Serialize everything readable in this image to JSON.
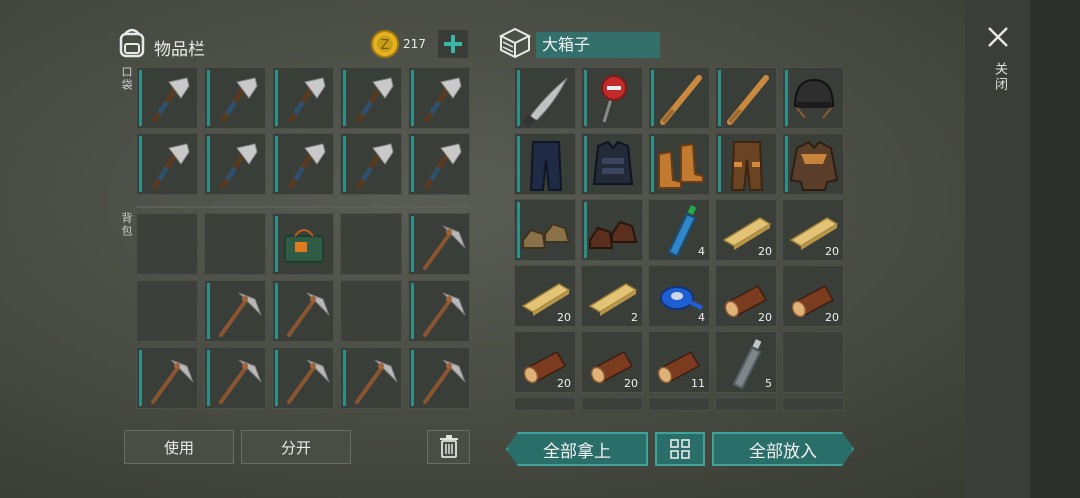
{
  "inventory": {
    "title": "物品栏",
    "coins": "217",
    "pocket_label": "口袋",
    "backpack_label": "背包"
  },
  "container": {
    "title": "大箱子"
  },
  "buttons": {
    "use": "使用",
    "split": "分开",
    "take_all": "全部拿上",
    "put_all": "全部放入"
  },
  "close_label": "关闭",
  "pocket_items": [
    "pickaxe",
    "pickaxe",
    "pickaxe",
    "pickaxe",
    "pickaxe",
    "pickaxe",
    "pickaxe",
    "pickaxe",
    "pickaxe",
    "pickaxe"
  ],
  "backpack_items": [
    "",
    "",
    "tackle-box",
    "",
    "stone-pick",
    "",
    "stone-pick",
    "stone-pick",
    "",
    "stone-pick",
    "stone-pick",
    "stone-pick",
    "stone-pick",
    "stone-pick",
    "stone-pick"
  ],
  "chest_items": [
    {
      "icon": "machete",
      "count": ""
    },
    {
      "icon": "stop-sign",
      "count": ""
    },
    {
      "icon": "bat",
      "count": ""
    },
    {
      "icon": "bat",
      "count": ""
    },
    {
      "icon": "helmet",
      "count": ""
    },
    {
      "icon": "pants-blue",
      "count": ""
    },
    {
      "icon": "vest",
      "count": ""
    },
    {
      "icon": "boots-orange",
      "count": ""
    },
    {
      "icon": "pants-brown",
      "count": ""
    },
    {
      "icon": "jacket",
      "count": ""
    },
    {
      "icon": "shoes-tan",
      "count": ""
    },
    {
      "icon": "shoes-brown",
      "count": ""
    },
    {
      "icon": "water-bottle",
      "count": "4"
    },
    {
      "icon": "plank",
      "count": "20"
    },
    {
      "icon": "plank",
      "count": "20"
    },
    {
      "icon": "plank",
      "count": "20"
    },
    {
      "icon": "plank",
      "count": "2"
    },
    {
      "icon": "tape",
      "count": "4"
    },
    {
      "icon": "log",
      "count": "20"
    },
    {
      "icon": "log",
      "count": "20"
    },
    {
      "icon": "log",
      "count": "20"
    },
    {
      "icon": "log",
      "count": "20"
    },
    {
      "icon": "log",
      "count": "11"
    },
    {
      "icon": "empty-bottle",
      "count": "5"
    },
    {
      "icon": "",
      "count": ""
    }
  ],
  "colors": {
    "accent": "#2d8f8a",
    "coin": "#d9a41c",
    "plus": "#37b7a8"
  }
}
